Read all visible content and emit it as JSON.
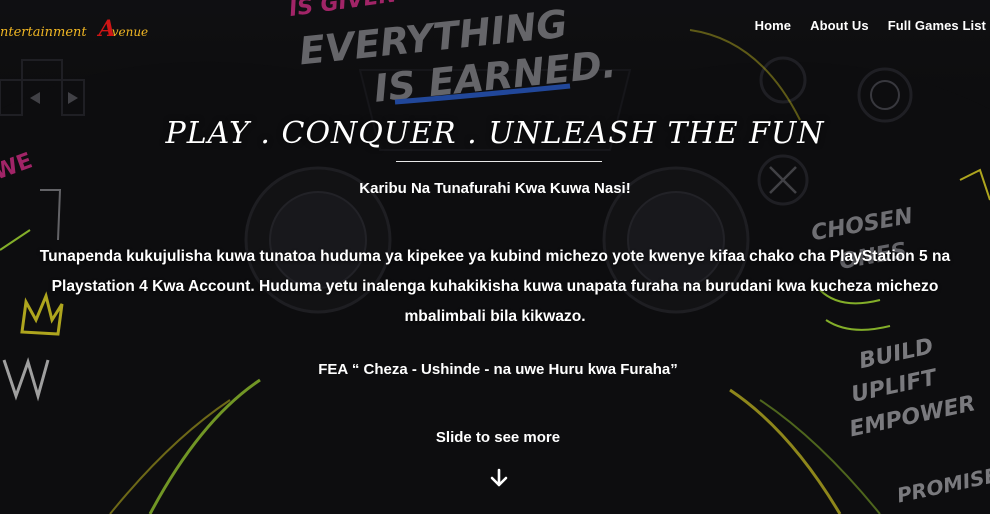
{
  "header": {
    "logo_part1": "ntertainment",
    "logo_initial": "A",
    "logo_part2": "venue",
    "nav": [
      {
        "label": "Home"
      },
      {
        "label": "About Us"
      },
      {
        "label": "Full Games List"
      }
    ]
  },
  "background_graphic": {
    "slogan_line1": "IS GIVEN",
    "slogan_line2": "EVERYTHING",
    "slogan_line3": "IS EARNED.",
    "left_text": "WE",
    "right_text1": "CHOSEN",
    "right_text2": "ONES",
    "right_text3": "BUILD",
    "right_text4": "UPLIFT",
    "right_text5": "EMPOWER",
    "right_text6": "PROMISE"
  },
  "hero": {
    "headline": "PLAY . CONQUER . UNLEASH THE FUN",
    "welcome": "Karibu Na Tunafurahi Kwa Kuwa Nasi!",
    "body": "Tunapenda kukujulisha kuwa tunatoa huduma ya kipekee ya kubind michezo yote kwenye kifaa chako cha PlayStation 5 na Playstation 4 Kwa Account. Huduma yetu inalenga kuhakikisha kuwa unapata furaha na burudani kwa kucheza michezo mbalimbali bila kikwazo.",
    "motto": "FEA “ Cheza - Ushinde - na uwe Huru kwa Furaha”",
    "scroll_hint": "Slide to see more",
    "scroll_icon": "arrow-down-icon"
  },
  "colors": {
    "logo_gold": "#f0b623",
    "logo_red": "#cf1515",
    "neon_green": "#b6f23a",
    "neon_yellow": "#f2e52a",
    "neon_pink": "#e0338f",
    "neon_blue": "#2e63d6"
  }
}
